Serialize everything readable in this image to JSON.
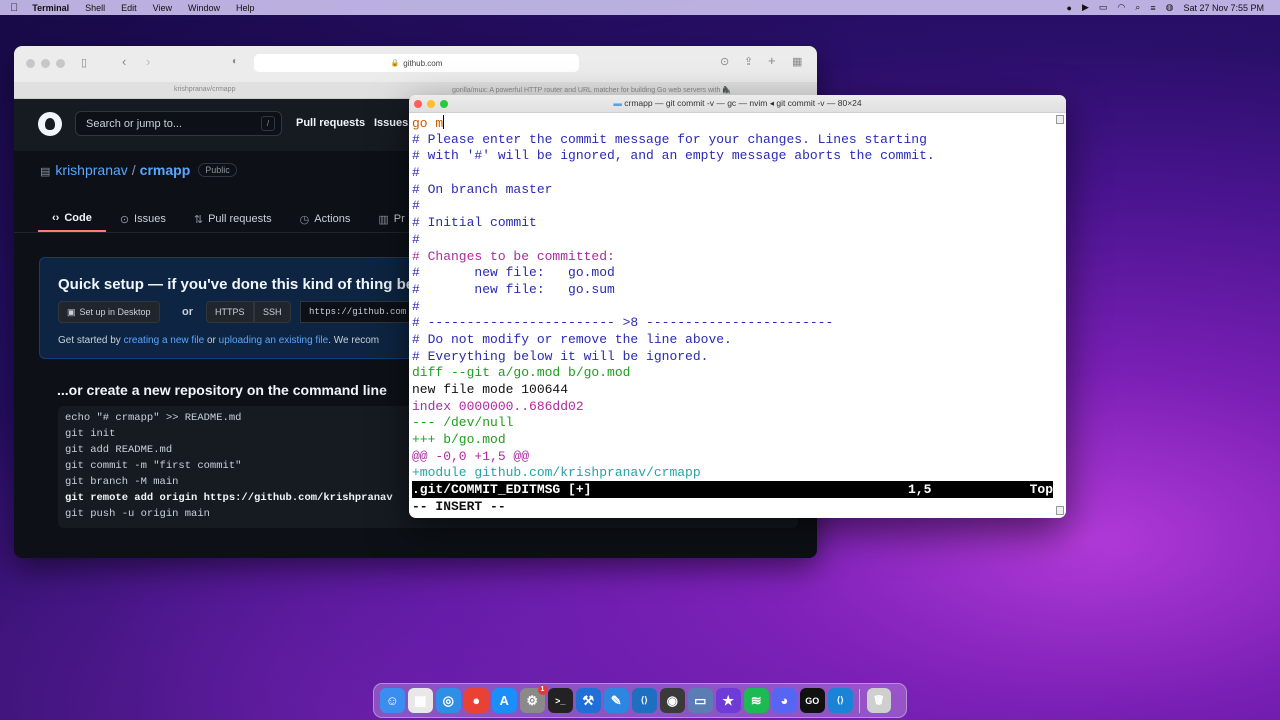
{
  "menubar": {
    "app_name": "Terminal",
    "menus": [
      "Shell",
      "Edit",
      "View",
      "Window",
      "Help"
    ],
    "datetime": "Sat 27 Nov  7:55 PM"
  },
  "safari": {
    "url": "github.com",
    "tabs": [
      "krishpranav/crmapp",
      "gorilla/mux: A powerful HTTP router and URL matcher for building Go web servers with 🦍"
    ],
    "github": {
      "search_placeholder": "Search or jump to...",
      "search_shortcut": "/",
      "nav": [
        "Pull requests",
        "Issues"
      ],
      "repo_owner": "krishpranav",
      "repo_sep": "/",
      "repo_name": "crmapp",
      "visibility": "Public",
      "repo_tabs": [
        "Code",
        "Issues",
        "Pull requests",
        "Actions",
        "Pr"
      ],
      "quick_setup_title": "Quick setup — if you've done this kind of thing befo",
      "setup_desktop": "Set up in Desktop",
      "or": "or",
      "https": "HTTPS",
      "ssh": "SSH",
      "clone_url": "https://github.com",
      "get_started_prefix": "Get started by",
      "link_new_file": "creating a new file",
      "or_text": "or",
      "link_upload": "uploading an existing file",
      "recommend": ". We recom",
      "cmd_section_title": "...or create a new repository on the command line",
      "cmd_lines": [
        "echo \"# crmapp\" >> README.md",
        "git init",
        "git add README.md",
        "git commit -m \"first commit\"",
        "git branch -M main",
        "git remote add origin https://github.com/krishpranav",
        "git push -u origin main"
      ]
    }
  },
  "terminal": {
    "title": "crmapp — git commit -v — gc — nvim ◂ git commit -v — 80×24",
    "first_line": "go m",
    "lines": [
      {
        "text": "# Please enter the commit message for your changes. Lines starting",
        "cls": "c-comment"
      },
      {
        "text": "# with '#' will be ignored, and an empty message aborts the commit.",
        "cls": "c-comment"
      },
      {
        "text": "#",
        "cls": "c-comment"
      },
      {
        "text": "# On branch master",
        "cls": "c-comment"
      },
      {
        "text": "#",
        "cls": "c-comment"
      },
      {
        "text": "# Initial commit",
        "cls": "c-comment"
      },
      {
        "text": "#",
        "cls": "c-comment"
      },
      {
        "text": "# Changes to be committed:",
        "cls": "c-head"
      },
      {
        "text": "#       new file:   go.mod",
        "cls": "c-comment"
      },
      {
        "text": "#       new file:   go.sum",
        "cls": "c-comment"
      },
      {
        "text": "#",
        "cls": "c-comment"
      },
      {
        "text": "# ------------------------ >8 ------------------------",
        "cls": "c-comment"
      },
      {
        "text": "# Do not modify or remove the line above.",
        "cls": "c-comment"
      },
      {
        "text": "# Everything below it will be ignored.",
        "cls": "c-comment"
      },
      {
        "text": "diff --git a/go.mod b/go.mod",
        "cls": "c-diff"
      },
      {
        "text": "new file mode 100644",
        "cls": "c-plain"
      },
      {
        "text": "index 0000000..686dd02",
        "cls": "c-index"
      },
      {
        "text": "--- /dev/null",
        "cls": "c-diff"
      },
      {
        "text": "+++ b/go.mod",
        "cls": "c-diff"
      },
      {
        "text": "@@ -0,0 +1,5 @@",
        "cls": "c-hunk"
      },
      {
        "text": "+module github.com/krishpranav/crmapp",
        "cls": "c-add"
      }
    ],
    "status_file": ".git/COMMIT_EDITMSG [+]",
    "status_pos": "1,5",
    "status_scroll": "Top",
    "mode": "-- INSERT --"
  },
  "dock": {
    "items": [
      {
        "name": "finder-icon",
        "color": "#3b8ef0",
        "glyph": "☺"
      },
      {
        "name": "launchpad-icon",
        "color": "#e8e8e8",
        "glyph": "▦"
      },
      {
        "name": "safari-icon",
        "color": "#2f8fe6",
        "glyph": "◎"
      },
      {
        "name": "chrome-icon",
        "color": "#e94235",
        "glyph": "●"
      },
      {
        "name": "app-store-icon",
        "color": "#1c8ef9",
        "glyph": "A"
      },
      {
        "name": "system-preferences-icon",
        "color": "#8a8a8a",
        "glyph": "⚙",
        "badge": "1"
      },
      {
        "name": "terminal-icon",
        "color": "#222222",
        "glyph": ">_"
      },
      {
        "name": "xcode-icon",
        "color": "#1f6fd6",
        "glyph": "⚒"
      },
      {
        "name": "xcode-alt-icon",
        "color": "#2d86e0",
        "glyph": "✎"
      },
      {
        "name": "vscode-icon",
        "color": "#1e6fbf",
        "glyph": "⟨⟩"
      },
      {
        "name": "quicktime-icon",
        "color": "#3a3a3a",
        "glyph": "◉"
      },
      {
        "name": "preview-icon",
        "color": "#5b7db3",
        "glyph": "▭"
      },
      {
        "name": "imovie-icon",
        "color": "#6e3bd6",
        "glyph": "★"
      },
      {
        "name": "spotify-icon",
        "color": "#1db954",
        "glyph": "≋"
      },
      {
        "name": "discord-icon",
        "color": "#5865f2",
        "glyph": "◕"
      },
      {
        "name": "goland-icon",
        "color": "#111111",
        "glyph": "GO"
      },
      {
        "name": "vscode-insiders-icon",
        "color": "#1a83d6",
        "glyph": "⟨⟩"
      },
      {
        "name": "trash-icon",
        "color": "#cfcfcf",
        "glyph": "🗑"
      }
    ]
  }
}
